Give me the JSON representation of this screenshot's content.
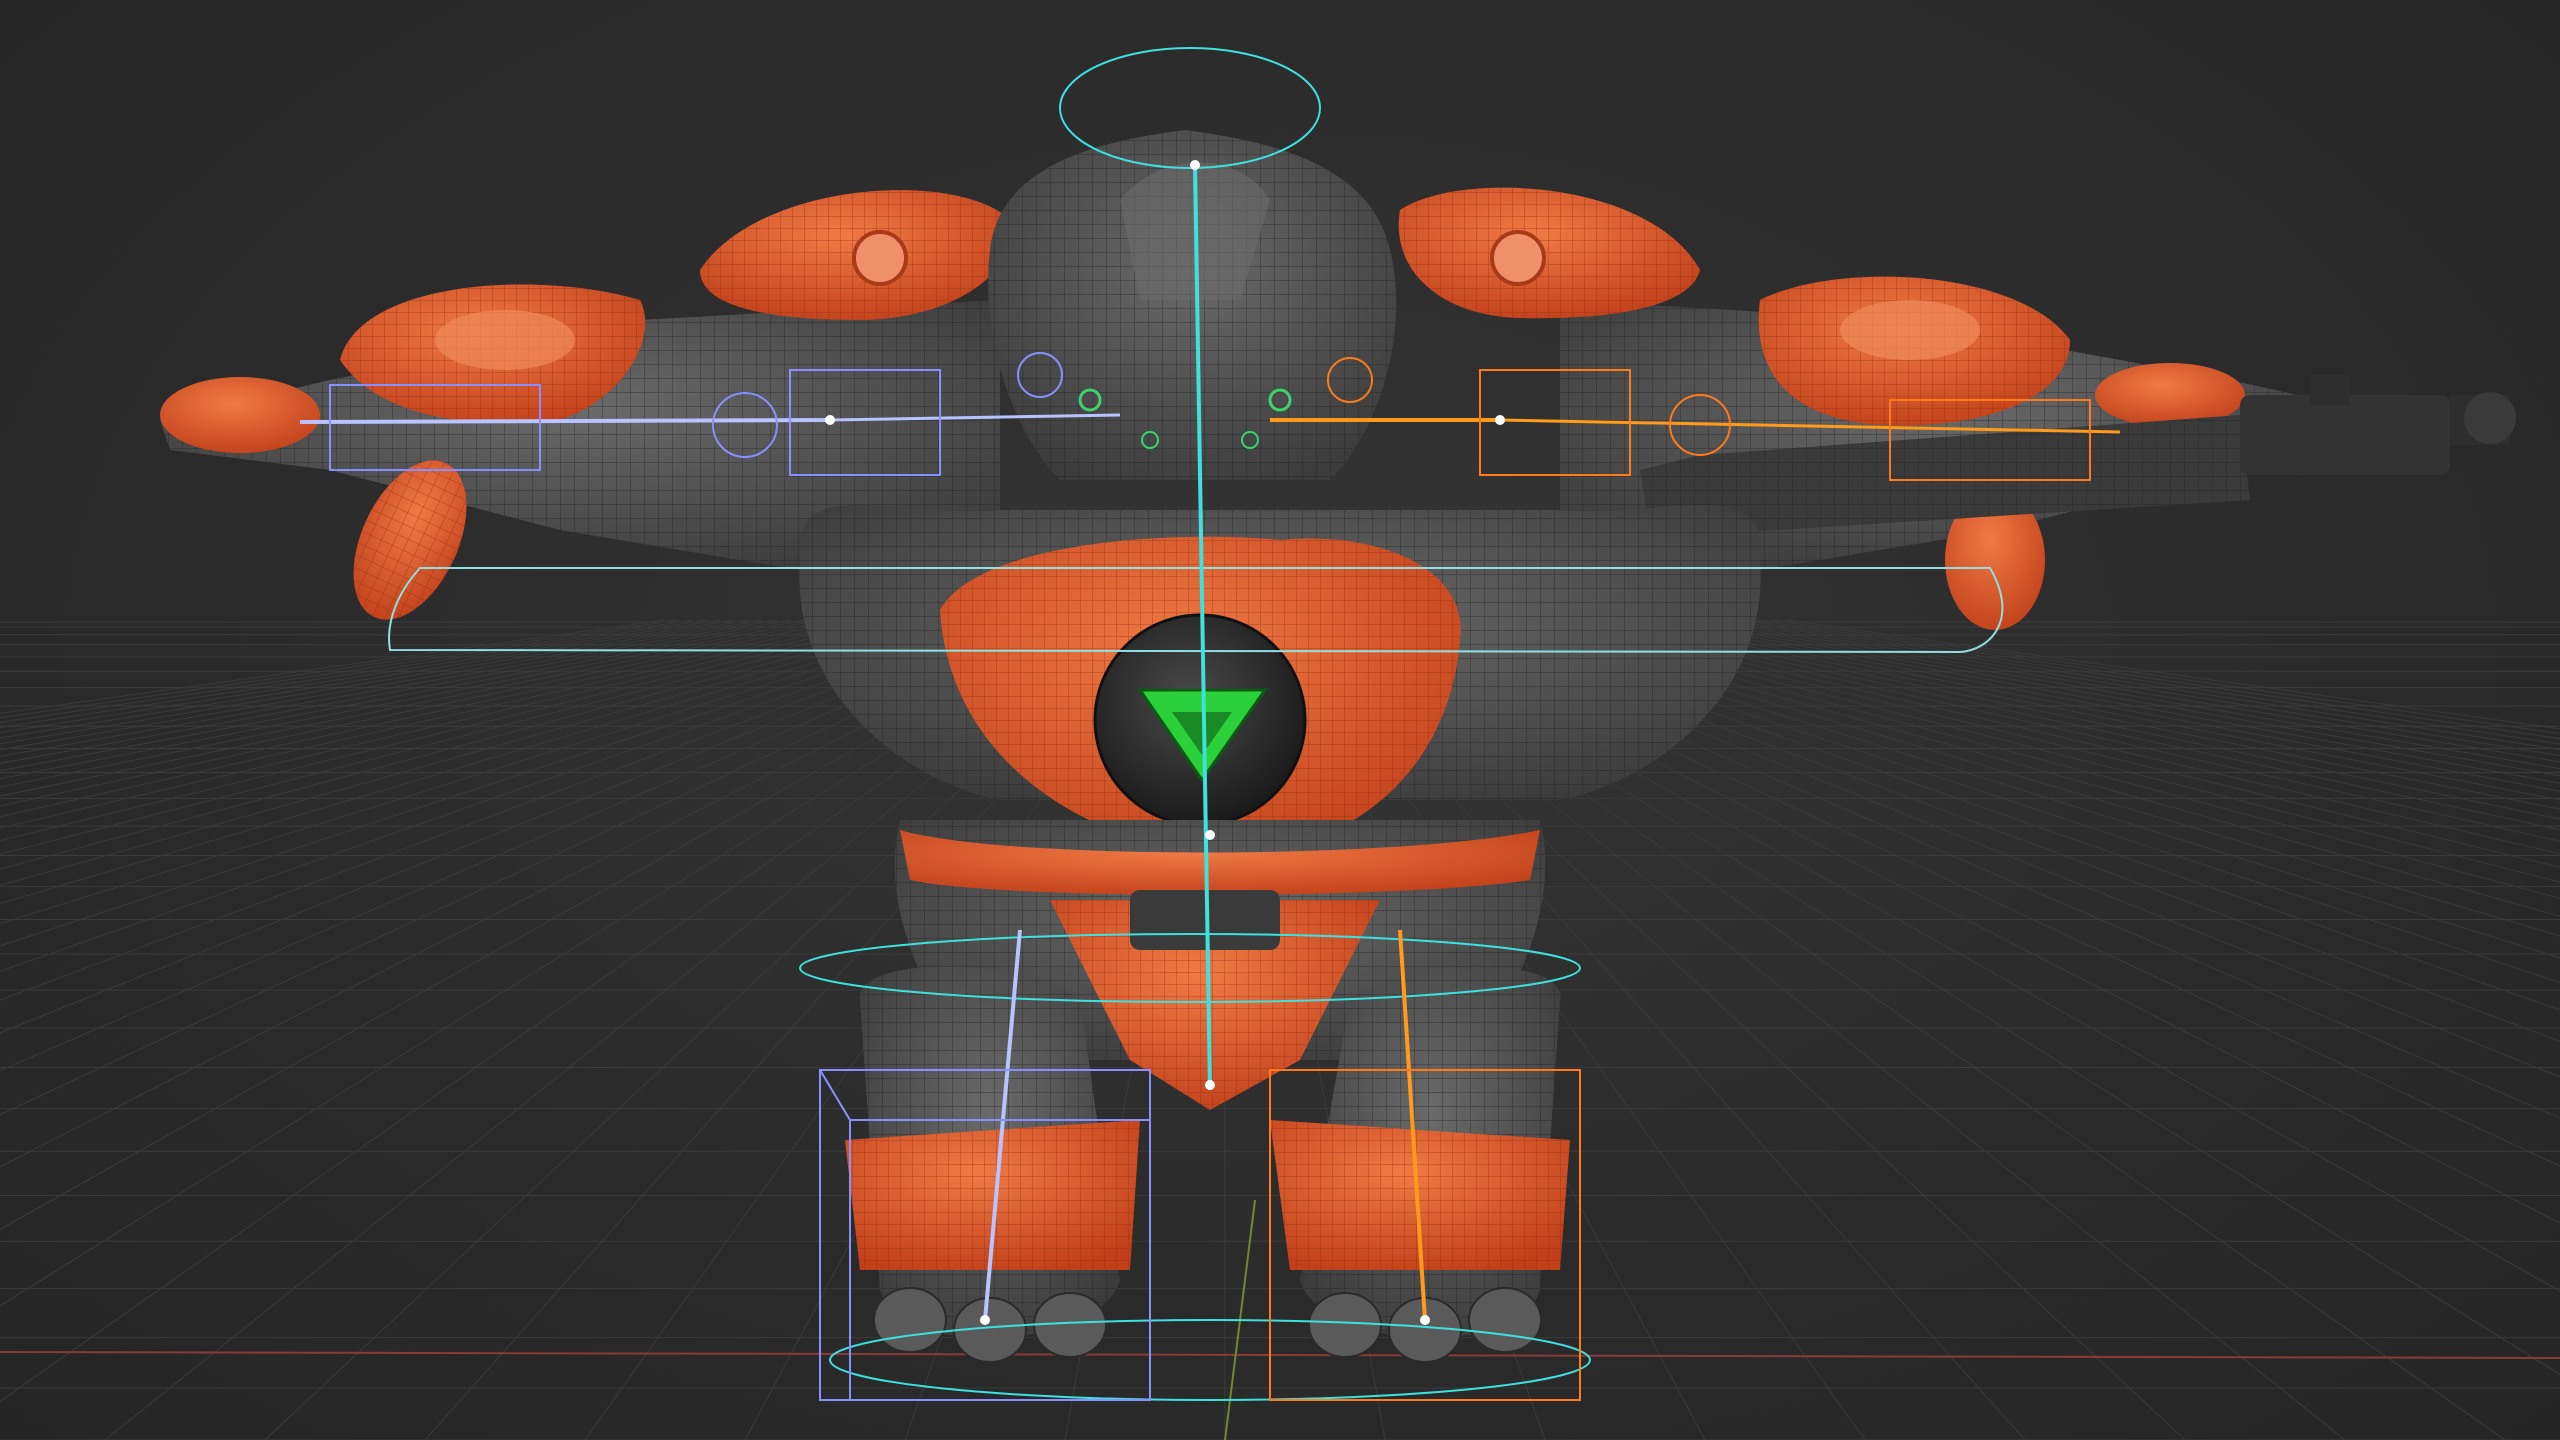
{
  "viewport": {
    "background": "#2b2b2b",
    "grid_color": "#3a3a3a",
    "x_axis_color": "#8a3a3a",
    "y_axis_color": "#6f8a2a"
  },
  "character": {
    "armor_color": "#e0562a",
    "body_color": "#5a5a5a",
    "wire_color": "#222222",
    "emblem_color": "#2ad13a"
  },
  "rig": {
    "center_color": "#3fe0e0",
    "left_color": "#b9c3ff",
    "right_color": "#ff9a1a",
    "face_color": "#3bd36b"
  }
}
